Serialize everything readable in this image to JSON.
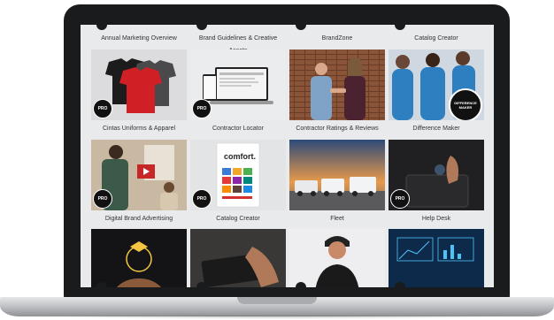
{
  "captions_top": [
    "Annual Marketing Overview",
    "Brand Guidelines & Creative Assets",
    "BrandZone",
    "Catalog Creator"
  ],
  "tiles": [
    {
      "caption": "Cintas Uniforms & Apparel",
      "badge": "PRO"
    },
    {
      "caption": "Contractor Locator",
      "badge": "PRO"
    },
    {
      "caption": "Contractor Ratings & Reviews",
      "badge": ""
    },
    {
      "caption": "Difference Maker",
      "badge": ""
    },
    {
      "caption": "Digital Brand Advertising",
      "badge": "PRO"
    },
    {
      "caption": "Catalog Creator",
      "badge": "PRO"
    },
    {
      "caption": "Fleet",
      "badge": ""
    },
    {
      "caption": "Help Desk",
      "badge": "PRO"
    }
  ],
  "seal_text": "DIFFERENCE MAKER",
  "catalog_cover_text": "comfort."
}
